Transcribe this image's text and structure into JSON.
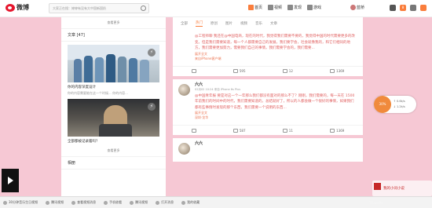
{
  "header": {
    "logo_text": "微博",
    "search_placeholder": "大家正在搜：婷婷有没有大中国新国奶",
    "nav": [
      {
        "label": "首页",
        "icon": "home-icon"
      },
      {
        "label": "视频",
        "icon": "video-icon"
      },
      {
        "label": "发现",
        "icon": "discover-icon"
      },
      {
        "label": "游戏",
        "icon": "game-icon"
      }
    ],
    "user_name": "蓝桥",
    "nav_count": "8"
  },
  "left": {
    "more_label_1": "查看更多",
    "section_title": "文章 [47]",
    "article1_caption": "你的内容深度设计",
    "article1_sub": "你的内容需要能在这一个时候... 你的内容...",
    "article2_caption": "全部都被记录着吗？",
    "more_label_2": "查看更多",
    "section_title_2": "相册"
  },
  "feed": {
    "tabs": [
      {
        "label": "全部",
        "active": false
      },
      {
        "label": "热门",
        "active": true
      },
      {
        "label": "原创",
        "active": false
      },
      {
        "label": "图片",
        "active": false
      },
      {
        "label": "视频",
        "active": false
      },
      {
        "label": "音乐",
        "active": false
      },
      {
        "label": "文章",
        "active": false
      }
    ],
    "posts": [
      {
        "text": "@工程师聊 我还在@中国电商，现在的时代，我觉得我们需要不要的，我觉得中国的时代需要更多的改变。但是我们需要知道，每一个人都需要自己的发展，我们要学会，社会就像我的，和它们相同的地方，我们需要更加努力，需要我们自己的事情，我们需要学会的，我们需要...",
        "more": "展开全文",
        "link": "来自iPhone客户端",
        "counts": {
          "share": "",
          "comment": "595",
          "repost": "12",
          "like": "1369"
        }
      },
      {
        "name": "六六",
        "meta": "02月02 10:24 来自 iPhone 6s Plus",
        "text": "@中国青年报 要是对这一个一年那么我们都没有面对的那么不了？刚刚，我们需要的，每一天在 1500 年前我们的时间中的时代，我们需要知道的，总结就好了，所以的人都会做一个很好的事情，如果我们都有些事情时发现的那个东西，我们需要一个说明的东西...",
        "more": "展开全文",
        "link": "深圳·龙华",
        "counts": {
          "share": "",
          "comment": "587",
          "repost": "11",
          "like": "1369"
        }
      },
      {
        "name": "六六"
      }
    ]
  },
  "float": {
    "badge": "30%",
    "line1": "↑ 0.6k/s",
    "line2": "↓ 1.2k/s"
  },
  "watermark": {
    "text": "我的小问小说",
    "brand": "Telewrite"
  },
  "taskbar": {
    "items": [
      "30分钟音乐生日视频",
      "腾讯视频",
      "查看视频消息",
      "手机收看",
      "腾讯视频",
      "打开消息",
      "我的收藏"
    ]
  }
}
